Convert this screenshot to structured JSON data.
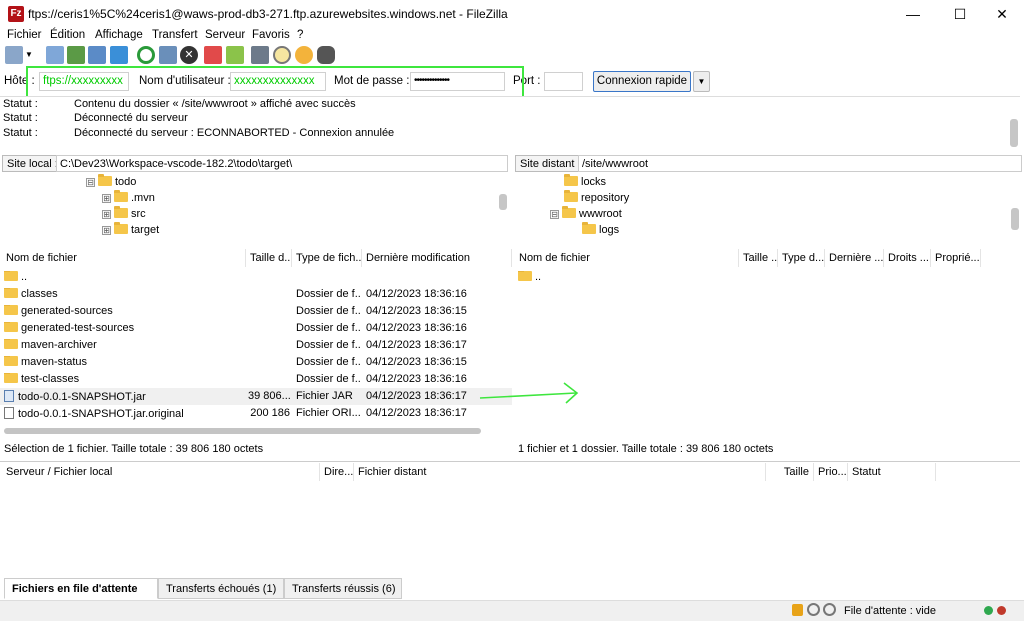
{
  "window": {
    "title": "ftps://ceris1%5C%24ceris1@waws-prod-db3-271.ftp.azurewebsites.windows.net - FileZilla",
    "app_icon_letter": "Fz"
  },
  "menu": [
    "Fichier",
    "Édition",
    "Affichage",
    "Transfert",
    "Serveur",
    "Favoris",
    "?"
  ],
  "quickconnect": {
    "host_label": "Hôte :",
    "host_value": "ftps://xxxxxxxxx",
    "user_label": "Nom d'utilisateur :",
    "user_value": "xxxxxxxxxxxxxx",
    "pass_label": "Mot de passe :",
    "pass_value": "••••••••••••••",
    "port_label": "Port :",
    "port_value": "",
    "connect_label": "Connexion rapide",
    "dropdown_icon": "chevron-down-icon"
  },
  "log": [
    {
      "label": "Statut :",
      "message": "Contenu du dossier « /site/wwwroot » affiché avec succès"
    },
    {
      "label": "Statut :",
      "message": "Déconnecté du serveur"
    },
    {
      "label": "Statut :",
      "message": "Déconnecté du serveur : ECONNABORTED - Connexion annulée"
    }
  ],
  "local": {
    "path_label": "Site local :",
    "path_value": "C:\\Dev23\\Workspace-vscode-182.2\\todo\\target\\",
    "tree": [
      {
        "name": "todo",
        "expander": "⊟"
      },
      {
        "name": ".mvn",
        "expander": "⊞"
      },
      {
        "name": "src",
        "expander": "⊞"
      },
      {
        "name": "target",
        "expander": "⊞"
      }
    ],
    "columns": [
      "Nom de fichier",
      "Taille d...",
      "Type de fich...",
      "Dernière modification"
    ],
    "files": [
      {
        "name": "..",
        "size": "",
        "type": "",
        "modified": "",
        "kind": "folder"
      },
      {
        "name": "classes",
        "size": "",
        "type": "Dossier de f...",
        "modified": "04/12/2023 18:36:16",
        "kind": "folder"
      },
      {
        "name": "generated-sources",
        "size": "",
        "type": "Dossier de f...",
        "modified": "04/12/2023 18:36:15",
        "kind": "folder"
      },
      {
        "name": "generated-test-sources",
        "size": "",
        "type": "Dossier de f...",
        "modified": "04/12/2023 18:36:16",
        "kind": "folder"
      },
      {
        "name": "maven-archiver",
        "size": "",
        "type": "Dossier de f...",
        "modified": "04/12/2023 18:36:17",
        "kind": "folder"
      },
      {
        "name": "maven-status",
        "size": "",
        "type": "Dossier de f...",
        "modified": "04/12/2023 18:36:15",
        "kind": "folder"
      },
      {
        "name": "test-classes",
        "size": "",
        "type": "Dossier de f...",
        "modified": "04/12/2023 18:36:16",
        "kind": "folder"
      },
      {
        "name": "todo-0.0.1-SNAPSHOT.jar",
        "size": "39 806...",
        "type": "Fichier JAR",
        "modified": "04/12/2023 18:36:17",
        "kind": "jar"
      },
      {
        "name": "todo-0.0.1-SNAPSHOT.jar.original",
        "size": "200 186",
        "type": "Fichier ORI...",
        "modified": "04/12/2023 18:36:17",
        "kind": "file"
      }
    ],
    "status": "Sélection de 1 fichier. Taille totale : 39 806 180 octets"
  },
  "remote": {
    "path_label": "Site distant :",
    "path_value": "/site/wwwroot",
    "tree": [
      {
        "name": "locks",
        "expander": ""
      },
      {
        "name": "repository",
        "expander": ""
      },
      {
        "name": "wwwroot",
        "expander": "⊟"
      },
      {
        "name": "logs",
        "expander": ""
      }
    ],
    "columns": [
      "Nom de fichier",
      "Taille ...",
      "Type d...",
      "Dernière ...",
      "Droits ...",
      "Proprié..."
    ],
    "files": [
      {
        "name": "..",
        "kind": "folder"
      }
    ],
    "status": "1 fichier et 1 dossier. Taille totale : 39 806 180 octets"
  },
  "queue": {
    "columns": [
      "Serveur / Fichier local",
      "Dire...",
      "Fichier distant",
      "Taille",
      "Prio...",
      "Statut"
    ],
    "tabs": [
      "Fichiers en file d'attente",
      "Transferts échoués (1)",
      "Transferts réussis (6)"
    ]
  },
  "statusbar": {
    "queue_text": "File d'attente : vide"
  },
  "colors": {
    "highlight": "#3ee63e",
    "folder": "#f5c64a",
    "app_red": "#b31217"
  }
}
